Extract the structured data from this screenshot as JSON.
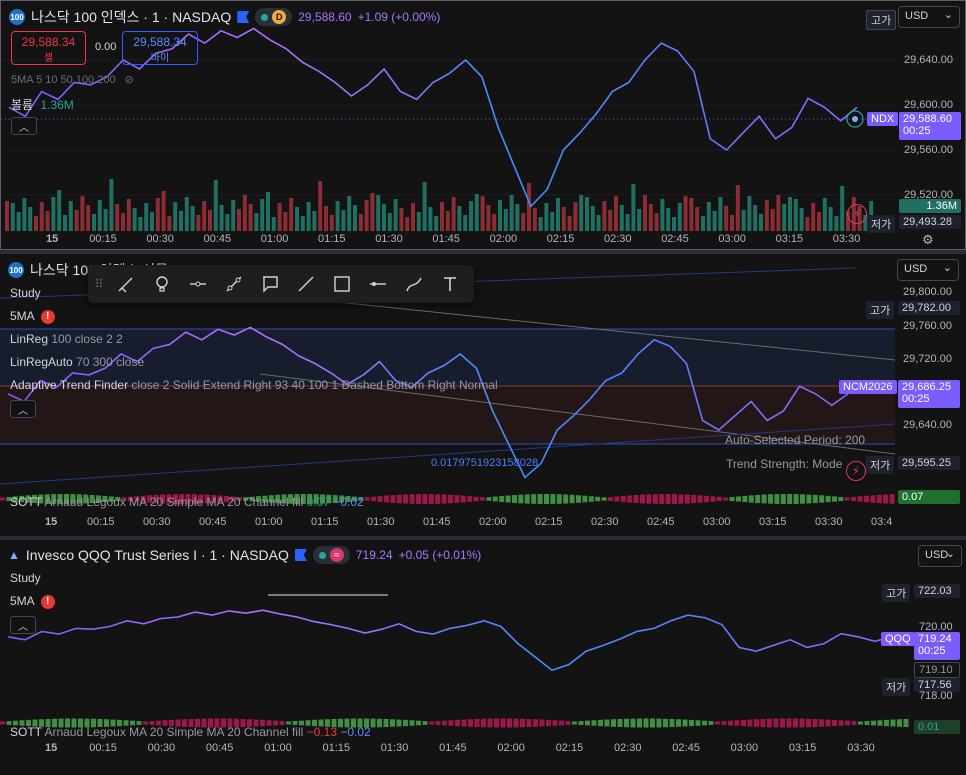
{
  "panes": [
    {
      "id": "ndx",
      "header": {
        "title": "나스닥 100 인덱스 · 1 · NASDAQ",
        "logo": "100",
        "badge": "D",
        "last": "29,588.60",
        "change": "+1.09 (+0.00%)"
      },
      "sell": {
        "price": "29,588.34",
        "label": "셀"
      },
      "buy": {
        "price": "29,588.34",
        "label": "바이"
      },
      "spread": "0.00",
      "ma_legend": "5MA 5 10 50 100 200",
      "volume_label": "볼륨",
      "volume_value": "1.36M",
      "currency": "USD",
      "axis_ticks": [
        "29,640.00",
        "29,600.00",
        "29,560.00",
        "29,520.00"
      ],
      "high_tag": "고가",
      "low_tag": "저가",
      "low_value": "29,493.28",
      "sym_tag": "NDX",
      "price_tag": "29,588.60",
      "countdown": "00:25",
      "vol_tag": "1.36M",
      "time_ticks": [
        "15",
        "00:15",
        "00:30",
        "00:45",
        "01:00",
        "01:15",
        "01:30",
        "01:45",
        "02:00",
        "02:15",
        "02:30",
        "02:45",
        "03:00",
        "03:15",
        "03:30"
      ],
      "colors": {
        "line_a": "#7b5cff",
        "line_b": "#b56bff",
        "line_c": "#3fa0ff",
        "vol_up": "#1f6f63",
        "vol_down": "#8a2e33"
      },
      "price_series": [
        29598,
        29590,
        29612,
        29605,
        29620,
        29618,
        29625,
        29640,
        29632,
        29646,
        29650,
        29663,
        29655,
        29666,
        29660,
        29668,
        29658,
        29650,
        29638,
        29630,
        29620,
        29608,
        29618,
        29632,
        29612,
        29605,
        29620,
        29628,
        29640,
        29625,
        29580,
        29545,
        29510,
        29525,
        29560,
        29575,
        29592,
        29612,
        29620,
        29640,
        29655,
        29648,
        29630,
        29570,
        29560,
        29575,
        29590,
        29570,
        29580,
        29606,
        29598,
        29586,
        29598
      ]
    },
    {
      "id": "ncm",
      "header": {
        "title": "나스닥 100 인덱스 선물 · 1 · CME",
        "logo": "100"
      },
      "legend": {
        "study": "Study",
        "ma": "5MA",
        "linreg_name": "LinReg",
        "linreg_params": "100 close 2 2",
        "linregauto_name": "LinRegAuto",
        "linregauto_params": "70 300 close",
        "atf_name": "Adaptive Trend Finder",
        "atf_params": "close 2 Solid Extend Right 93 40 100 1 Dashed Bottom Right Normal"
      },
      "currency": "USD",
      "axis_ticks": [
        "29,800.00",
        "29,760.00",
        "29,720.00",
        "29,640.00"
      ],
      "high_tag": "고가",
      "high_value": "29,782.00",
      "low_tag": "저가",
      "low_value": "29,595.25",
      "sym_tag": "NCM2026",
      "price_tag": "29,686.25",
      "countdown": "00:25",
      "auto_period": "Auto-Selected Period: 200",
      "trend_strength": "Trend Strength: Mode",
      "pearson": "0.0179751923158028",
      "sott_name": "SOTT",
      "sott_params": "Arnaud Legoux MA 20 Simple MA 20 Channel fill",
      "sott_v1": "0.07",
      "sott_v2": "−0.02",
      "sott_tag": "0.07",
      "time_ticks": [
        "15",
        "00:15",
        "00:30",
        "00:45",
        "01:00",
        "01:15",
        "01:30",
        "01:45",
        "02:00",
        "02:15",
        "02:30",
        "02:45",
        "03:00",
        "03:15",
        "03:30",
        "03:4"
      ]
    },
    {
      "id": "qqq",
      "header": {
        "title": "Invesco QQQ Trust Series I · 1 · NASDAQ",
        "last": "719.24",
        "change": "+0.05 (+0.01%)"
      },
      "legend": {
        "study": "Study",
        "ma": "5MA"
      },
      "currency": "USD",
      "high_tag": "고가",
      "high_value": "722.03",
      "axis_ticks": [
        "720.00",
        "718.00"
      ],
      "sym_tag": "QQQ",
      "price_tag": "719.24",
      "countdown": "00:25",
      "prev_tag": "719.10",
      "low_tag": "저가",
      "low_value": "717.56",
      "sott_name": "SOTT",
      "sott_params": "Arnaud Legoux MA 20 Simple MA 20 Channel fill",
      "sott_v1": "−0.13",
      "sott_v2": "−0.02",
      "sott_tag": "0.01",
      "time_ticks": [
        "15",
        "00:15",
        "00:30",
        "00:45",
        "01:00",
        "01:15",
        "01:30",
        "01:45",
        "02:00",
        "02:15",
        "02:30",
        "02:45",
        "03:00",
        "03:15",
        "03:30"
      ]
    }
  ],
  "toolbar_tools": [
    "brush-icon",
    "lightbulb-icon",
    "horizontal-ray-icon",
    "trend-line-icon",
    "callout-icon",
    "line-icon",
    "rectangle-icon",
    "horizontal-line-icon",
    "path-icon",
    "text-icon"
  ]
}
